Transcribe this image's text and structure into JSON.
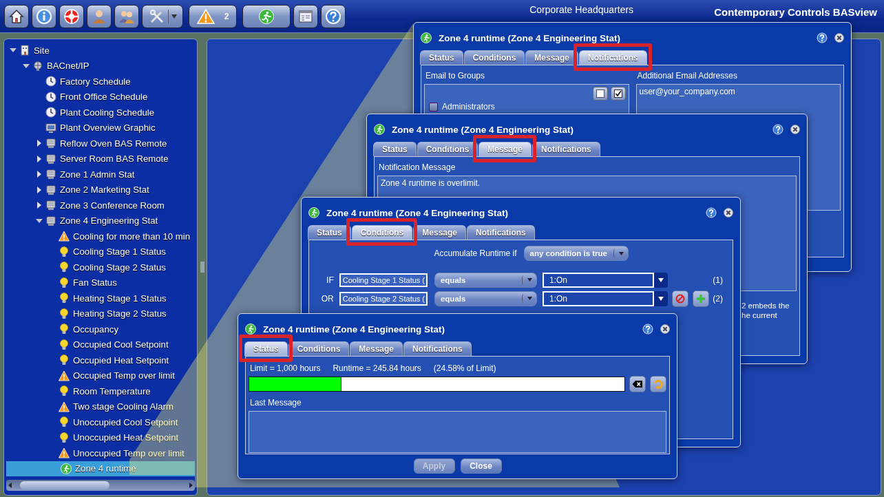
{
  "toolbar": {
    "buttons": [
      {
        "kind": "home"
      },
      {
        "kind": "info"
      },
      {
        "kind": "support"
      },
      {
        "kind": "user"
      },
      {
        "kind": "users"
      },
      {
        "kind": "tools"
      },
      {
        "kind": "alarms",
        "count": "2"
      },
      {
        "kind": "runtime"
      },
      {
        "kind": "window"
      },
      {
        "kind": "help"
      }
    ],
    "location": "Corporate Headquarters",
    "product": "Contemporary Controls BASview"
  },
  "tree": [
    {
      "label": "Site",
      "kind": "site",
      "expanded": true,
      "selected": false,
      "children": [
        {
          "label": "BACnet/IP",
          "kind": "network",
          "expanded": true,
          "selected": false,
          "children": [
            {
              "label": "Factory Schedule",
              "kind": "schedule",
              "selected": false
            },
            {
              "label": "Front Office Schedule",
              "kind": "schedule",
              "selected": false
            },
            {
              "label": "Plant Cooling Schedule",
              "kind": "schedule",
              "selected": false
            },
            {
              "label": "Plant Overview Graphic",
              "kind": "graphic",
              "selected": false
            },
            {
              "label": "Reflow Oven BAS Remote",
              "kind": "device",
              "expanded": false,
              "selected": false
            },
            {
              "label": "Server Room BAS Remote",
              "kind": "device",
              "expanded": false,
              "selected": false
            },
            {
              "label": "Zone 1 Admin Stat",
              "kind": "device",
              "expanded": false,
              "selected": false
            },
            {
              "label": "Zone 2 Marketing Stat",
              "kind": "device",
              "expanded": false,
              "selected": false
            },
            {
              "label": "Zone 3 Conference Room",
              "kind": "device",
              "expanded": false,
              "selected": false
            },
            {
              "label": "Zone 4 Engineering Stat",
              "kind": "device",
              "expanded": true,
              "selected": false,
              "children": [
                {
                  "label": "Cooling for more than 10 min",
                  "kind": "alarm",
                  "selected": false
                },
                {
                  "label": "Cooling Stage 1 Status",
                  "kind": "point",
                  "selected": false
                },
                {
                  "label": "Cooling Stage 2 Status",
                  "kind": "point",
                  "selected": false
                },
                {
                  "label": "Fan Status",
                  "kind": "point",
                  "selected": false
                },
                {
                  "label": "Heating Stage 1 Status",
                  "kind": "point",
                  "selected": false
                },
                {
                  "label": "Heating Stage 2 Status",
                  "kind": "point",
                  "selected": false
                },
                {
                  "label": "Occupancy",
                  "kind": "point",
                  "selected": false
                },
                {
                  "label": "Occupied Cool Setpoint",
                  "kind": "point",
                  "selected": false
                },
                {
                  "label": "Occupied Heat Setpoint",
                  "kind": "point",
                  "selected": false
                },
                {
                  "label": "Occupied Temp over limit",
                  "kind": "alarm",
                  "selected": false
                },
                {
                  "label": "Room Temperature",
                  "kind": "point",
                  "selected": false
                },
                {
                  "label": "Two stage Cooling Alarm",
                  "kind": "alarm",
                  "selected": false
                },
                {
                  "label": "Unoccupied Cool Setpoint",
                  "kind": "point",
                  "selected": false
                },
                {
                  "label": "Unoccupied Heat Setpoint",
                  "kind": "point",
                  "selected": false
                },
                {
                  "label": "Unoccupied Temp over limit",
                  "kind": "alarm",
                  "selected": false
                },
                {
                  "label": "Zone 4 runtime",
                  "kind": "runtime",
                  "selected": true
                }
              ]
            }
          ]
        }
      ]
    }
  ],
  "dialogs": [
    {
      "kind": "notifications",
      "title": "Zone 4 runtime (Zone 4 Engineering Stat)",
      "tabs": [
        {
          "label": "Status",
          "selected": false
        },
        {
          "label": "Conditions",
          "selected": false
        },
        {
          "label": "Message",
          "selected": false
        },
        {
          "label": "Notifications",
          "selected": true
        }
      ],
      "groups_label": "Email to Groups",
      "groups": [
        {
          "label": "Administrators",
          "checked": false
        }
      ],
      "addresses_label": "Additional Email Addresses",
      "addresses": "user@your_company.com"
    },
    {
      "kind": "message",
      "title": "Zone 4 runtime (Zone 4 Engineering Stat)",
      "tabs": [
        {
          "label": "Status",
          "selected": false
        },
        {
          "label": "Conditions",
          "selected": false
        },
        {
          "label": "Message",
          "selected": true
        },
        {
          "label": "Notifications",
          "selected": false
        }
      ],
      "message_label": "Notification Message",
      "message": "Zone 4 runtime is overlimit.",
      "hint_fragments": [
        "2 embeds the",
        "he current"
      ]
    },
    {
      "kind": "conditions",
      "title": "Zone 4 runtime (Zone 4 Engineering Stat)",
      "tabs": [
        {
          "label": "Status",
          "selected": false
        },
        {
          "label": "Conditions",
          "selected": true
        },
        {
          "label": "Message",
          "selected": false
        },
        {
          "label": "Notifications",
          "selected": false
        }
      ],
      "accumulate_label": "Accumulate Runtime if",
      "accumulate_value": "any condition is true",
      "conditions": [
        {
          "joiner": "IF",
          "point": "Cooling Stage 1 Status (",
          "operator": "equals",
          "value": "1:On",
          "index": "(1)",
          "removable": false
        },
        {
          "joiner": "OR",
          "point": "Cooling Stage 2 Status (",
          "operator": "equals",
          "value": "1:On",
          "index": "(2)",
          "removable": true
        }
      ]
    },
    {
      "kind": "status",
      "title": "Zone 4 runtime (Zone 4 Engineering Stat)",
      "tabs": [
        {
          "label": "Status",
          "selected": true
        },
        {
          "label": "Conditions",
          "selected": false
        },
        {
          "label": "Message",
          "selected": false
        },
        {
          "label": "Notifications",
          "selected": false
        }
      ],
      "limit": "Limit = 1,000 hours",
      "runtime": "Runtime = 245.84 hours",
      "percent": "(24.58% of Limit)",
      "level": 0.2458,
      "last_message_label": "Last Message",
      "buttons": [
        {
          "label": "Apply",
          "disabled": true
        },
        {
          "label": "Close",
          "disabled": false
        }
      ]
    }
  ]
}
